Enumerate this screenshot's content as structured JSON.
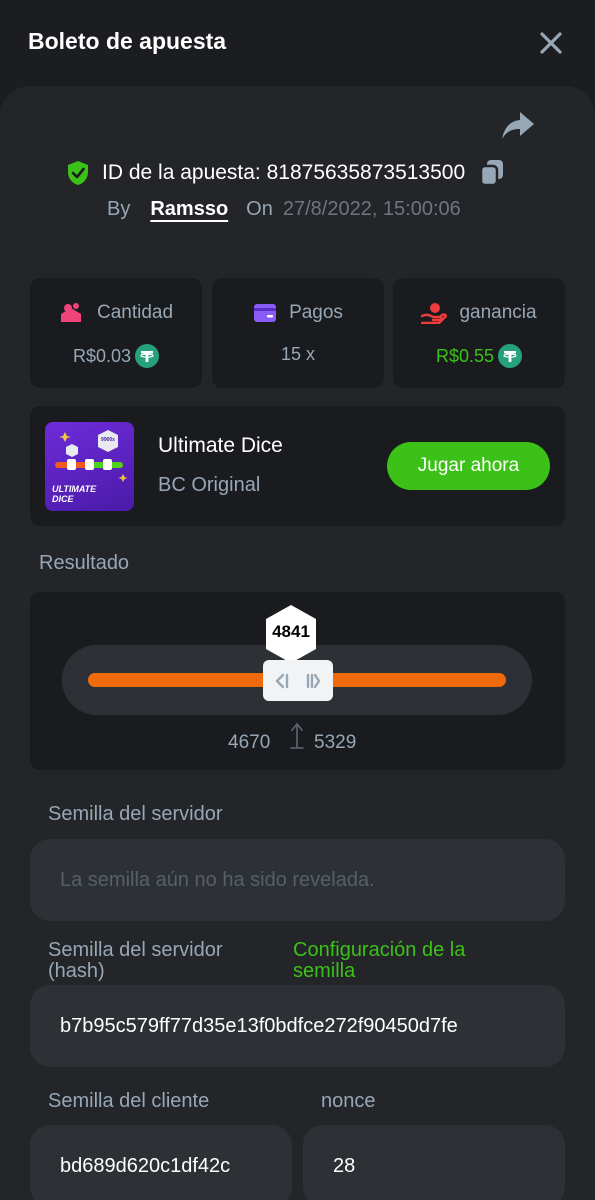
{
  "header": {
    "title": "Boleto de apuesta",
    "close_icon": "close-icon"
  },
  "bet": {
    "id_label": "ID de la apuesta: 81875635873513500",
    "by_label": "By",
    "user": "Ramsso",
    "on_label": "On",
    "date": "27/8/2022, 15:00:06"
  },
  "stats": [
    {
      "label": "Cantidad",
      "value": "R$0.03",
      "icon": "coins-icon",
      "color": "#f0437a"
    },
    {
      "label": "Pagos",
      "value": "15 x",
      "icon": "wallet-icon",
      "color": "#8a5cf6"
    },
    {
      "label": "ganancia",
      "value": "R$0.55",
      "icon": "profit-hand-icon",
      "color": "#ef3b3b"
    }
  ],
  "game": {
    "title": "Ultimate Dice",
    "subtitle": "BC Original",
    "play_label": "Jugar ahora",
    "thumb_text": "ULTIMATE DICE",
    "thumb_badge": "9900x"
  },
  "result": {
    "label": "Resultado",
    "value": "4841",
    "range_low": "4670",
    "range_high": "5329"
  },
  "server_seed": {
    "label": "Semilla del servidor",
    "placeholder": "La semilla aún no ha sido revelada."
  },
  "server_hash": {
    "label_line1": "Semilla del servidor",
    "label_line2": "(hash)",
    "config_line1": "Configuración de la",
    "config_line2": "semilla",
    "value": "b7b95c579ff77d35e13f0bdfce272f90450d7fe"
  },
  "client_seed": {
    "label": "Semilla del cliente",
    "value": "bd689d620c1df42c"
  },
  "nonce": {
    "label": "nonce",
    "value": "28"
  },
  "colors": {
    "accent_green": "#3bc117",
    "orange_bar": "#ef6a0b",
    "background": "#1c1d21",
    "panel": "#232529"
  }
}
